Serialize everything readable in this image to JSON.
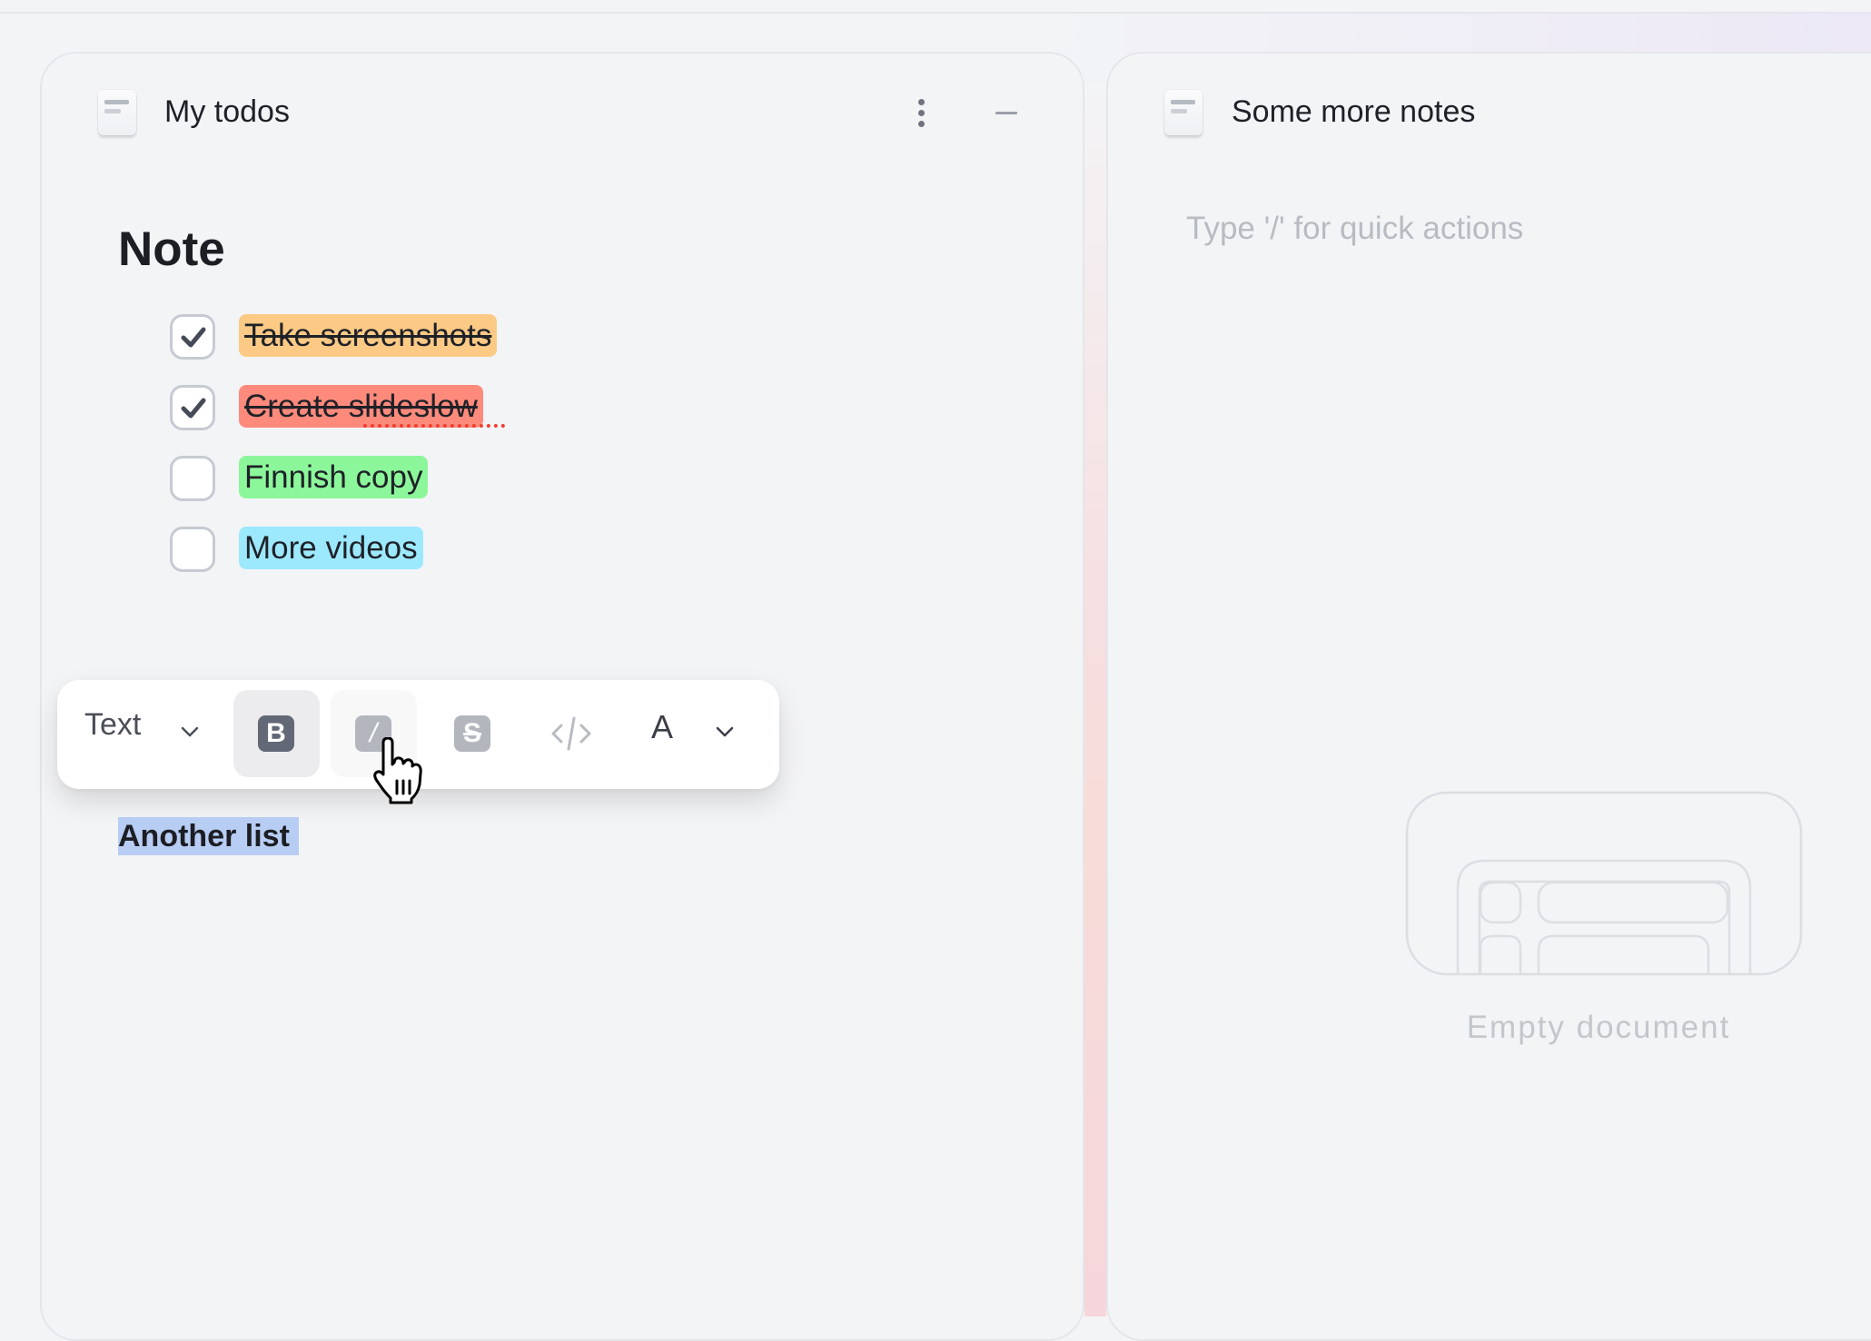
{
  "left_panel": {
    "title": "My todos",
    "icon": "document-icon",
    "actions": [
      "more-vertical-icon",
      "minimize-icon"
    ],
    "heading": "Note",
    "todos": [
      {
        "label": "Take screenshots",
        "checked": true,
        "highlight": "#fdca85"
      },
      {
        "label": "Create slideslow",
        "checked": true,
        "highlight": "#fe8a7c"
      },
      {
        "label": "Finnish copy",
        "checked": false,
        "highlight": "#8cf79a"
      },
      {
        "label": "More videos",
        "checked": false,
        "highlight": "#9ce9fd"
      }
    ],
    "selected_text": "Another list"
  },
  "toolbar": {
    "block_type": "Text",
    "buttons": [
      {
        "name": "bold",
        "glyph": "B",
        "state": "active"
      },
      {
        "name": "italic",
        "glyph": "/",
        "state": "hover"
      },
      {
        "name": "strikethrough",
        "glyph": "S",
        "state": "default"
      },
      {
        "name": "code",
        "glyph": "</>",
        "state": "default"
      }
    ],
    "color_label": "A"
  },
  "right_panel": {
    "title": "Some more notes",
    "icon": "document-icon",
    "placeholder": "Type '/' for quick actions",
    "empty_state_label": "Empty document"
  },
  "colors": {
    "background": "#f3f4f6",
    "selection": "#b8cdf3",
    "spellcheck": "#f23d2d"
  }
}
